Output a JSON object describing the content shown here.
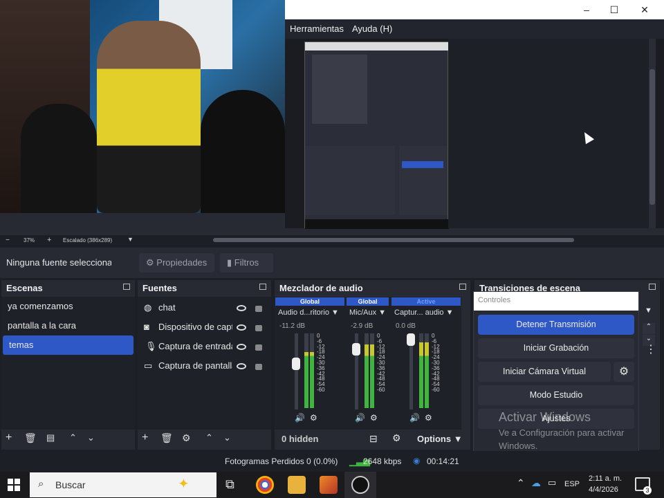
{
  "preview": {
    "window_menu": [
      "Herramientas",
      "Ayuda (H)"
    ],
    "zoom": "37%",
    "scaling": "Escalado (386x289)"
  },
  "context_bar": {
    "no_source": "Ninguna fuente seleccionada",
    "properties": "Propiedades",
    "filters": "Filtros"
  },
  "scenes": {
    "title": "Escenas",
    "items": [
      "ya comenzamos",
      "pantalla a la cara",
      "temas"
    ],
    "selected": 2
  },
  "sources": {
    "title": "Fuentes",
    "items": [
      {
        "label": "chat",
        "icon": "globe-icon"
      },
      {
        "label": "Dispositivo de captura",
        "icon": "camera-icon"
      },
      {
        "label": "Captura de entrada",
        "icon": "microphone-icon"
      },
      {
        "label": "Captura de pantalla",
        "icon": "monitor-icon"
      }
    ]
  },
  "mixer": {
    "title": "Mezclador de audio",
    "channels": [
      {
        "head": "Global",
        "name": "Audio d...ritorio",
        "db": "-11.2 dB",
        "level": 0.75,
        "fader": 0.62
      },
      {
        "head": "Global",
        "name": "Mic/Aux",
        "db": "-2.9 dB",
        "level": 0.85,
        "fader": 0.85
      },
      {
        "head": "Active",
        "name": "Captur... audio",
        "db": "0.0 dB",
        "level": 0.88,
        "fader": 1.0
      }
    ],
    "ticks": [
      "0",
      "-6",
      "-12",
      "-18",
      "-24",
      "-30",
      "-36",
      "-42",
      "-48",
      "-54",
      "-60"
    ],
    "hidden": "0 hidden",
    "options": "Options"
  },
  "transitions": {
    "title": "Transiciones de escena"
  },
  "controls": {
    "title": "Controles",
    "buttons": [
      "Detener Transmisión",
      "Iniciar Grabación",
      "Iniciar Cámara Virtual",
      "Modo Estudio",
      "Ajustes"
    ],
    "watermark_title": "Activar Windows",
    "watermark_text": "Ve a Configuración para activar Windows."
  },
  "status": {
    "dropped": "Fotogramas Perdidos 0 (0.0%)",
    "bitrate": "2648 kbps",
    "time": "00:14:21"
  },
  "taskbar": {
    "search": "Buscar",
    "lang": "ESP",
    "clock": "2:11 a. m.",
    "date": "4/4/2026",
    "notif": "3"
  },
  "colors": {
    "accent": "#2d58c6",
    "meter_green": "#3fb53f",
    "meter_yellow": "#c8c82d",
    "meter_red": "#c83c2d"
  }
}
